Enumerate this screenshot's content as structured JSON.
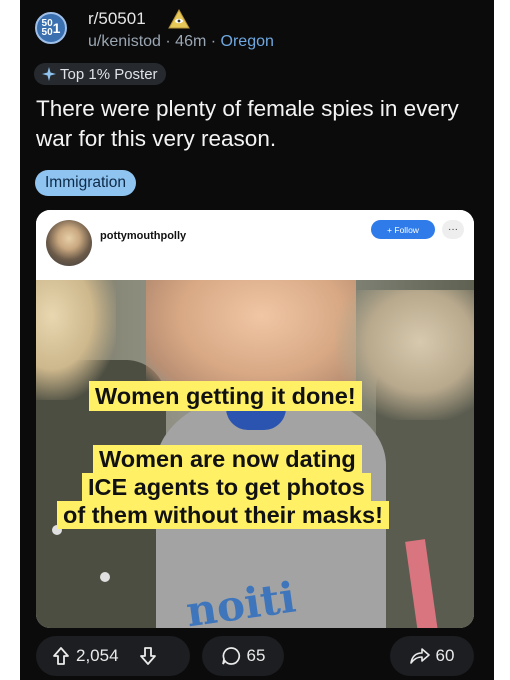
{
  "subreddit": {
    "icon_text_top": "50",
    "icon_text_bottom": "50",
    "icon_text_main": "1",
    "name": "r/50501",
    "badge_icon": "pyramid-eye-icon"
  },
  "post": {
    "author": "u/kenistod",
    "separator": "·",
    "age": "46m",
    "location": "Oregon",
    "user_flair": "Top 1% Poster",
    "title": "There were plenty of female spies in every war for this very reason.",
    "tag": "Immigration"
  },
  "embed": {
    "username": "pottymouthpolly",
    "follow_label": "+ Follow",
    "more_label": "···",
    "caption_line1": "Women getting it done!",
    "caption_line2": "Women are now dating",
    "caption_line3": "ICE agents to get photos",
    "caption_line4": "of them without their masks!",
    "shirt_text": "noiti"
  },
  "actions": {
    "upvotes": "2,054",
    "comments": "65",
    "shares": "60"
  },
  "colors": {
    "background": "#0b0b0c",
    "tag_pill": "#8fc3f0",
    "caption_highlight": "#fff066",
    "follow_button": "#2f7bea",
    "location_link": "#6fa8e0"
  }
}
